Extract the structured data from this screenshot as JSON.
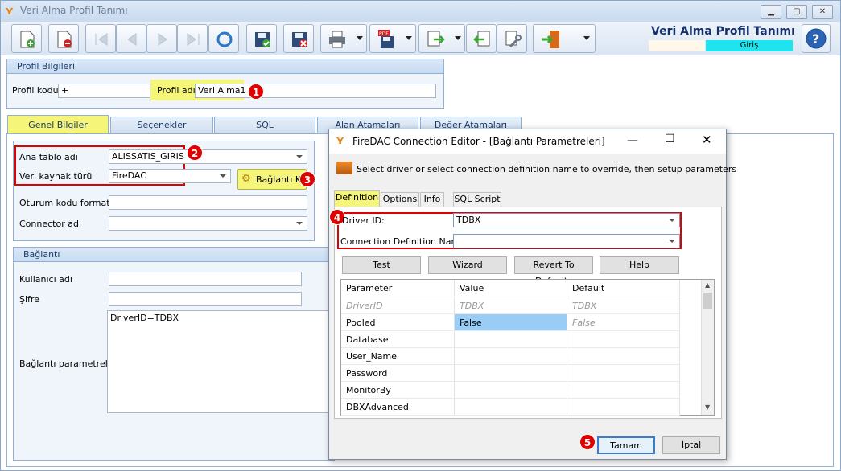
{
  "window": {
    "title": "Veri Alma Profil Tanımı",
    "header_title": "Veri Alma Profil Tanımı",
    "mode": "Giriş"
  },
  "profil": {
    "section": "Profil Bilgileri",
    "kod_label": "Profil kodu",
    "kod_value": "+",
    "ad_label": "Profil adı",
    "ad_value": "Veri Alma1"
  },
  "tabs": [
    "Genel Bilgiler",
    "Seçenekler",
    "SQL",
    "Alan Atamaları",
    "Değer Atamaları"
  ],
  "genel": {
    "ana_tablo_label": "Ana tablo adı",
    "ana_tablo_value": "ALISSATIS_GIRIS",
    "kaynak_label": "Veri kaynak türü",
    "kaynak_value": "FireDAC",
    "baglanti_kur": "Bağlantı Kur",
    "oturum_label": "Oturum kodu formatı",
    "connector_label": "Connector adı"
  },
  "baglanti": {
    "section": "Bağlantı",
    "kullanici_label": "Kullanıcı adı",
    "sifre_label": "Şifre",
    "param_label": "Bağlantı parametreleri",
    "param_value": "DriverID=TDBX"
  },
  "badges": [
    "1",
    "2",
    "3",
    "4",
    "5"
  ],
  "dialog": {
    "title": "FireDAC Connection Editor - [Bağlantı Parametreleri]",
    "description": "Select driver or select connection definition name to override, then setup parameters",
    "tabs": [
      "Definition",
      "Options",
      "Info",
      "SQL Script"
    ],
    "driver_label": "Driver ID:",
    "driver_value": "TDBX",
    "conndef_label": "Connection Definition Name:",
    "conndef_value": "",
    "buttons": {
      "test": "Test",
      "wizard": "Wizard",
      "revert": "Revert To Defaults",
      "help": "Help",
      "ok": "Tamam",
      "cancel": "İptal"
    },
    "grid": {
      "headers": [
        "Parameter",
        "Value",
        "Default"
      ],
      "rows": [
        [
          "DriverID",
          "TDBX",
          "TDBX"
        ],
        [
          "Pooled",
          "False",
          "False"
        ],
        [
          "Database",
          "",
          ""
        ],
        [
          "User_Name",
          "",
          ""
        ],
        [
          "Password",
          "",
          ""
        ],
        [
          "MonitorBy",
          "",
          ""
        ],
        [
          "DBXAdvanced",
          "",
          ""
        ]
      ]
    }
  }
}
